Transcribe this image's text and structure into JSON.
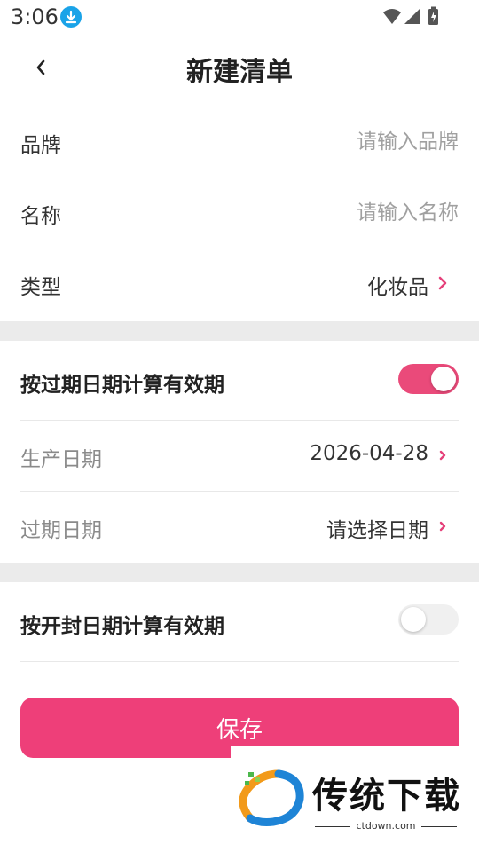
{
  "status_bar": {
    "time": "3:06",
    "icons": [
      "download-icon",
      "wifi-icon",
      "signal-icon",
      "battery-icon"
    ]
  },
  "header": {
    "title": "新建清单",
    "back_icon": "chevron-left-icon"
  },
  "form": {
    "brand": {
      "label": "品牌",
      "placeholder": "请输入品牌",
      "value": ""
    },
    "name": {
      "label": "名称",
      "placeholder": "请输入名称",
      "value": ""
    },
    "type": {
      "label": "类型",
      "value": "化妆品"
    }
  },
  "expiry_section": {
    "toggle_label": "按过期日期计算有效期",
    "toggle_on": true,
    "production_date": {
      "label": "生产日期",
      "value": "2026-04-28"
    },
    "expiry_date": {
      "label": "过期日期",
      "value": "请选择日期"
    }
  },
  "open_section": {
    "toggle_label": "按开封日期计算有效期",
    "toggle_on": false
  },
  "save_label": "保存",
  "watermark": {
    "text": "传统下载",
    "url": "ctdown.com"
  },
  "colors": {
    "accent": "#ee3f79",
    "toggle_on": "#ea4a7a",
    "chevron": "#e5407a",
    "divider_band": "#ebebeb"
  }
}
